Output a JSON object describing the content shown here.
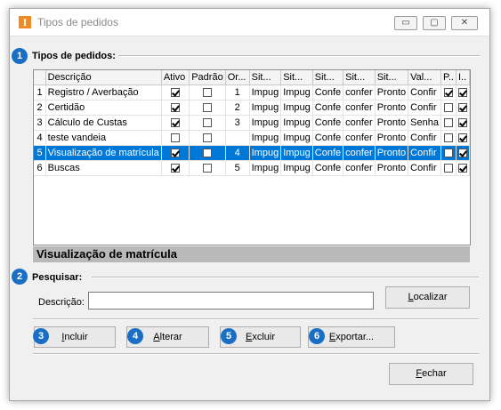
{
  "window": {
    "title": "Tipos de pedidos",
    "app_icon_letter": "I",
    "min_glyph": "▭",
    "max_glyph": "▢",
    "close_glyph": "✕"
  },
  "sections": {
    "grid_title": "Tipos de pedidos:",
    "grid_badge": "1",
    "search_title": "Pesquisar:",
    "search_badge": "2"
  },
  "grid": {
    "columns": [
      "Descrição",
      "Ativo",
      "Padrão",
      "Or...",
      "Sit...",
      "Sit...",
      "Sit...",
      "Sit...",
      "Sit...",
      "Val...",
      "P..",
      "I.."
    ],
    "rows": [
      {
        "num": "1",
        "desc": "Registro / Averbação",
        "ativo": true,
        "padrao": false,
        "ordem": "1",
        "s1": "Impug",
        "s2": "Impug",
        "s3": "Confe",
        "s4": "confer",
        "s5": "Pronto",
        "val": "Confir",
        "p": true,
        "i": true
      },
      {
        "num": "2",
        "desc": "Certidão",
        "ativo": true,
        "padrao": false,
        "ordem": "2",
        "s1": "Impug",
        "s2": "Impug",
        "s3": "Confe",
        "s4": "confer",
        "s5": "Pronto",
        "val": "Confir",
        "p": false,
        "i": true
      },
      {
        "num": "3",
        "desc": "Cálculo de Custas",
        "ativo": true,
        "padrao": false,
        "ordem": "3",
        "s1": "Impug",
        "s2": "Impug",
        "s3": "Confe",
        "s4": "confer",
        "s5": "Pronto",
        "val": "Senha",
        "p": false,
        "i": true
      },
      {
        "num": "4",
        "desc": "teste vandeia",
        "ativo": false,
        "padrao": false,
        "ordem": "",
        "s1": "Impug",
        "s2": "Impug",
        "s3": "Confe",
        "s4": "confer",
        "s5": "Pronto",
        "val": "Confir",
        "p": false,
        "i": true
      },
      {
        "num": "5",
        "desc": "Visualização de matrícula",
        "ativo": true,
        "padrao": false,
        "ordem": "4",
        "s1": "Impug",
        "s2": "Impug",
        "s3": "Confe",
        "s4": "confer",
        "s5": "Pronto",
        "val": "Confir",
        "p": false,
        "i": true,
        "selected": true
      },
      {
        "num": "6",
        "desc": "Buscas",
        "ativo": true,
        "padrao": false,
        "ordem": "5",
        "s1": "Impug",
        "s2": "Impug",
        "s3": "Confe",
        "s4": "confer",
        "s5": "Pronto",
        "val": "Confir",
        "p": false,
        "i": true
      }
    ]
  },
  "preview": {
    "title": "Visualização de matrícula"
  },
  "search": {
    "label": "Descrição:",
    "value": "",
    "button_prefix": "",
    "button_mnemonic": "L",
    "button_rest": "ocalizar"
  },
  "actions": [
    {
      "badge": "3",
      "mnemonic": "I",
      "rest": "ncluir"
    },
    {
      "badge": "4",
      "mnemonic": "A",
      "rest": "lterar"
    },
    {
      "badge": "5",
      "mnemonic": "E",
      "rest": "xcluir"
    },
    {
      "badge": "6",
      "mnemonic": "E",
      "rest": "xportar..."
    }
  ],
  "footer": {
    "close_mnemonic": "F",
    "close_rest": "echar"
  },
  "colors": {
    "badge": "#1a6fc4",
    "selection": "#0078d7",
    "app_icon": "#f08a24"
  }
}
